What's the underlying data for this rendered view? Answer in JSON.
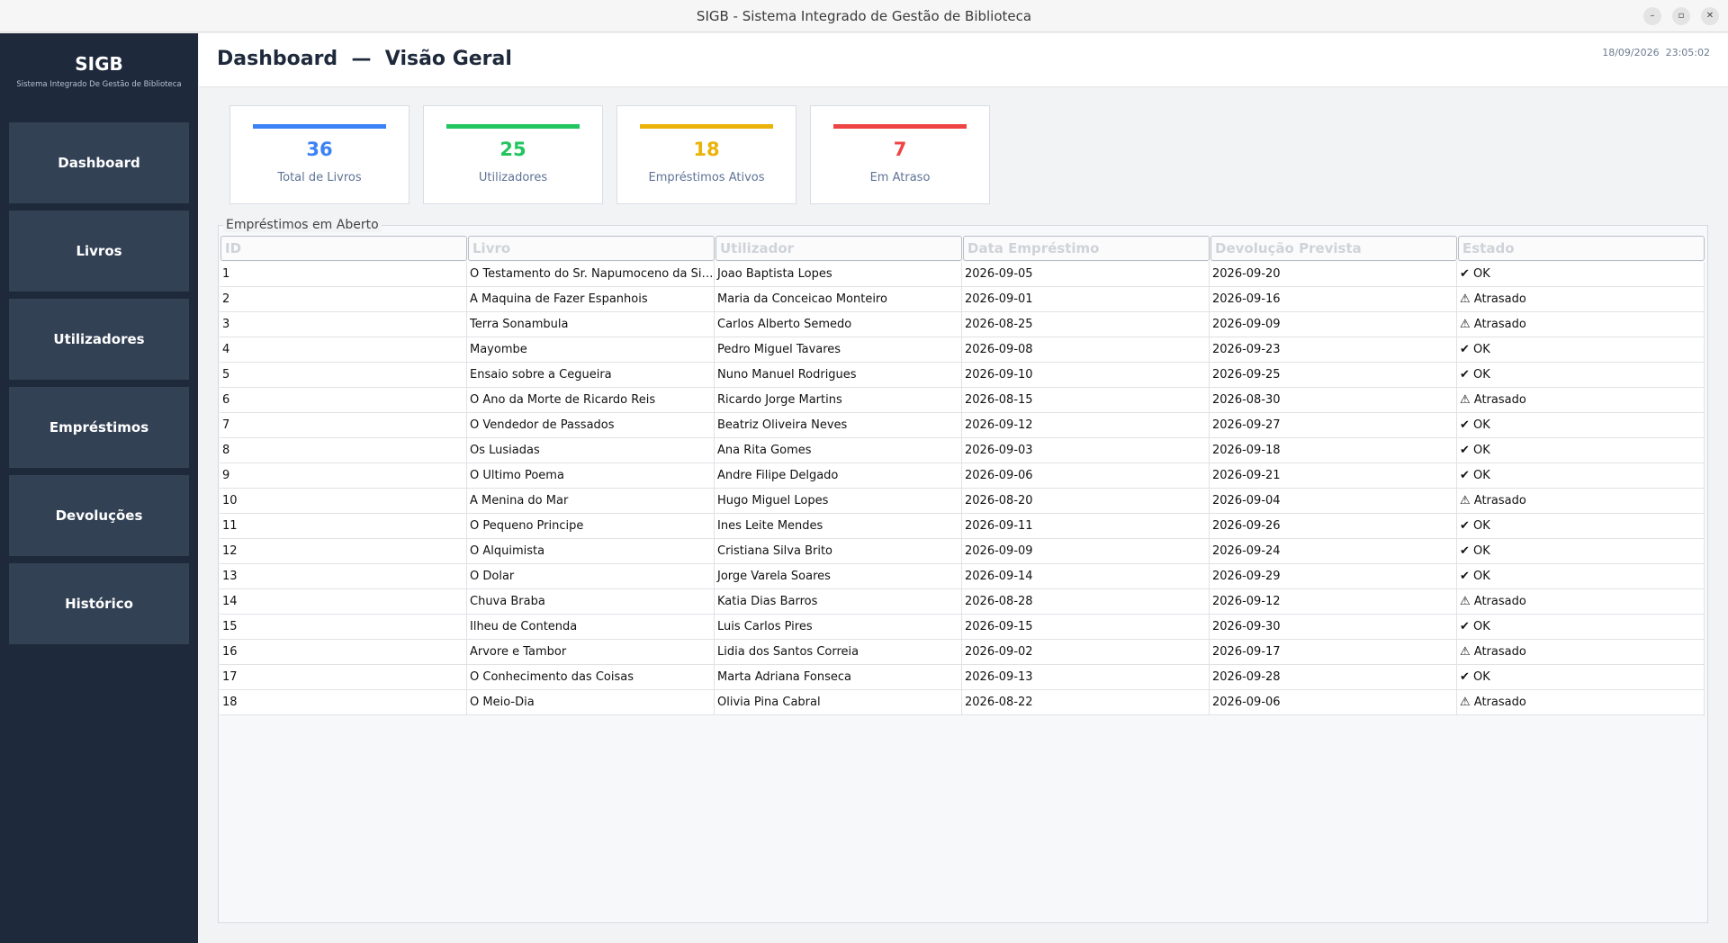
{
  "window": {
    "title": "SIGB - Sistema Integrado de Gestão de Biblioteca",
    "minimize_label": "–",
    "maximize_label": "▫",
    "close_label": "✕"
  },
  "sidebar": {
    "brand": "SIGB",
    "subtitle": "Sistema Integrado  De Gestão de Biblioteca",
    "items": [
      {
        "label": "Dashboard"
      },
      {
        "label": "Livros"
      },
      {
        "label": "Utilizadores"
      },
      {
        "label": "Empréstimos"
      },
      {
        "label": "Devoluções"
      },
      {
        "label": "Histórico"
      }
    ]
  },
  "header": {
    "title": "Dashboard  —  Visão Geral",
    "datetime": "18/09/2026  23:05:02"
  },
  "cards": [
    {
      "value": "36",
      "label": "Total de Livros",
      "color": "#3b82f6"
    },
    {
      "value": "25",
      "label": "Utilizadores",
      "color": "#22c55e"
    },
    {
      "value": "18",
      "label": "Empréstimos Ativos",
      "color": "#eab308"
    },
    {
      "value": "7",
      "label": "Em Atraso",
      "color": "#ef4444"
    }
  ],
  "loans": {
    "title": "Empréstimos em Aberto",
    "columns": [
      "ID",
      "Livro",
      "Utilizador",
      "Data Empréstimo",
      "Devolução Prevista",
      "Estado"
    ],
    "rows": [
      [
        "1",
        "O Testamento do Sr. Napumoceno da Silva Araujo",
        "Joao Baptista Lopes",
        "2026-09-05",
        "2026-09-20",
        "✔ OK"
      ],
      [
        "2",
        "A Maquina de Fazer Espanhois",
        "Maria da Conceicao Monteiro",
        "2026-09-01",
        "2026-09-16",
        "⚠ Atrasado"
      ],
      [
        "3",
        "Terra Sonambula",
        "Carlos Alberto Semedo",
        "2026-08-25",
        "2026-09-09",
        "⚠ Atrasado"
      ],
      [
        "4",
        "Mayombe",
        "Pedro Miguel Tavares",
        "2026-09-08",
        "2026-09-23",
        "✔ OK"
      ],
      [
        "5",
        "Ensaio sobre a Cegueira",
        "Nuno Manuel Rodrigues",
        "2026-09-10",
        "2026-09-25",
        "✔ OK"
      ],
      [
        "6",
        "O Ano da Morte de Ricardo Reis",
        "Ricardo Jorge Martins",
        "2026-08-15",
        "2026-08-30",
        "⚠ Atrasado"
      ],
      [
        "7",
        "O Vendedor de Passados",
        "Beatriz Oliveira Neves",
        "2026-09-12",
        "2026-09-27",
        "✔ OK"
      ],
      [
        "8",
        "Os Lusiadas",
        "Ana Rita Gomes",
        "2026-09-03",
        "2026-09-18",
        "✔ OK"
      ],
      [
        "9",
        "O Ultimo Poema",
        "Andre Filipe Delgado",
        "2026-09-06",
        "2026-09-21",
        "✔ OK"
      ],
      [
        "10",
        "A Menina do Mar",
        "Hugo Miguel Lopes",
        "2026-08-20",
        "2026-09-04",
        "⚠ Atrasado"
      ],
      [
        "11",
        "O Pequeno Principe",
        "Ines Leite Mendes",
        "2026-09-11",
        "2026-09-26",
        "✔ OK"
      ],
      [
        "12",
        "O Alquimista",
        "Cristiana Silva Brito",
        "2026-09-09",
        "2026-09-24",
        "✔ OK"
      ],
      [
        "13",
        "O Dolar",
        "Jorge Varela Soares",
        "2026-09-14",
        "2026-09-29",
        "✔ OK"
      ],
      [
        "14",
        "Chuva Braba",
        "Katia Dias Barros",
        "2026-08-28",
        "2026-09-12",
        "⚠ Atrasado"
      ],
      [
        "15",
        "Ilheu de Contenda",
        "Luis Carlos Pires",
        "2026-09-15",
        "2026-09-30",
        "✔ OK"
      ],
      [
        "16",
        "Arvore e Tambor",
        "Lidia dos Santos Correia",
        "2026-09-02",
        "2026-09-17",
        "⚠ Atrasado"
      ],
      [
        "17",
        "O Conhecimento das Coisas",
        "Marta Adriana Fonseca",
        "2026-09-13",
        "2026-09-28",
        "✔ OK"
      ],
      [
        "18",
        "O Meio-Dia",
        "Olivia Pina Cabral",
        "2026-08-22",
        "2026-09-06",
        "⚠ Atrasado"
      ]
    ]
  }
}
